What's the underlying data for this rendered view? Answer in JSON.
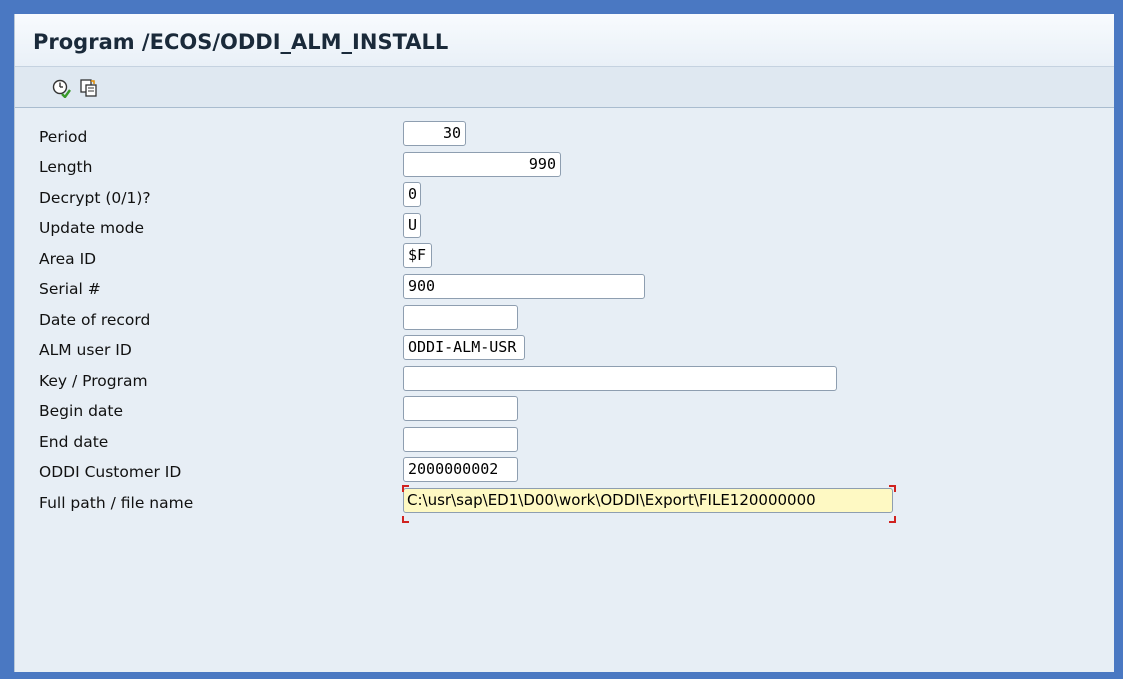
{
  "window": {
    "title": "Program /ECOS/ODDI_ALM_INSTALL"
  },
  "toolbar": {
    "buttons": [
      {
        "icon": "execute-clock-icon"
      },
      {
        "icon": "get-variant-icon"
      }
    ]
  },
  "fields": [
    {
      "label": "Period",
      "value": "30"
    },
    {
      "label": "Length",
      "value": "990"
    },
    {
      "label": "Decrypt (0/1)?",
      "value": "0"
    },
    {
      "label": "Update mode",
      "value": "U"
    },
    {
      "label": "Area ID",
      "value": "$F"
    },
    {
      "label": "Serial #",
      "value": "900"
    },
    {
      "label": "Date of record",
      "value": ""
    },
    {
      "label": "ALM user ID",
      "value": "ODDI-ALM-USR"
    },
    {
      "label": "Key / Program",
      "value": ""
    },
    {
      "label": "Begin date",
      "value": ""
    },
    {
      "label": "End date",
      "value": ""
    },
    {
      "label": "ODDI Customer ID",
      "value": "2000000002"
    },
    {
      "label": "Full path / file name",
      "value": "C:\\usr\\sap\\ED1\\D00\\work\\ODDI\\Export\\FILE120000000"
    }
  ],
  "colors": {
    "background": "#4a78c2",
    "panel": "#e7eef5",
    "required_highlight": "#fef9c3",
    "required_marker": "#d0221f"
  }
}
